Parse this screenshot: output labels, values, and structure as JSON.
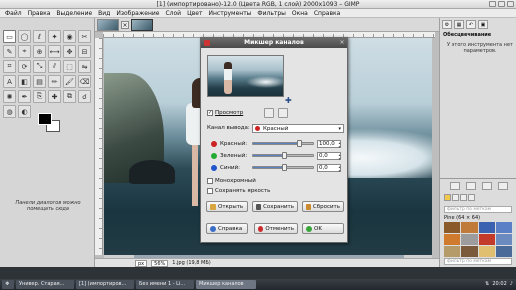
{
  "window": {
    "title": "[1] (импортировано)-12.0 (Цвета RGB, 1 слой) 2000x1093 – GIMP"
  },
  "menu": [
    "Файл",
    "Правка",
    "Выделение",
    "Вид",
    "Изображение",
    "Слой",
    "Цвет",
    "Инструменты",
    "Фильтры",
    "Окна",
    "Справка"
  ],
  "toolbox": {
    "tools": [
      "rect-select-icon",
      "ellipse-select-icon",
      "lasso-icon",
      "fuzzy-select-icon",
      "color-select-icon",
      "scissors-icon",
      "paths-icon",
      "color-picker-icon",
      "zoom-icon",
      "measure-icon",
      "move-icon",
      "align-icon",
      "crop-icon",
      "rotate-icon",
      "scale-icon",
      "shear-icon",
      "perspective-icon",
      "flip-icon",
      "text-icon",
      "bucket-fill-icon",
      "blend-icon",
      "pencil-icon",
      "paintbrush-icon",
      "eraser-icon",
      "airbrush-icon",
      "ink-icon",
      "clone-icon",
      "heal-icon",
      "perspective-clone-icon",
      "smudge-icon",
      "blur-icon",
      "dodge-icon"
    ],
    "tool_glyphs": [
      "▭",
      "◯",
      "ℓ",
      "✦",
      "◉",
      "✂",
      "✎",
      "⌖",
      "⊕",
      "⟷",
      "✥",
      "⊟",
      "⌗",
      "⟳",
      "⤡",
      "⫽",
      "⬚",
      "⇋",
      "A",
      "◧",
      "▤",
      "✏",
      "🖌",
      "⌫",
      "✺",
      "✒",
      "⎘",
      "✚",
      "⧉",
      "☌",
      "◍",
      "◐"
    ],
    "panel_note": "Панели диалогов можно помещать сюда"
  },
  "image_window": {
    "zoom_unit": "px",
    "zoom": "56%",
    "file_info": "1.jpg (19,8 МБ)"
  },
  "dock": {
    "title": "Обесцвечивание",
    "message": "У этого инструмента нет параметров.",
    "filter_placeholder": "фильтр по меткам",
    "pattern_label": "Pine (64 × 64)",
    "pattern_colors": [
      "#8a5a2b",
      "#c07a3a",
      "#3a62b0",
      "#5b7fc7",
      "#d07a2e",
      "#9c9c9c",
      "#c33a2a",
      "#6a8ac0",
      "#b59b6a",
      "#7a5a3a",
      "#e0c070",
      "#4a6a9a"
    ]
  },
  "dialog": {
    "title": "Микшер каналов",
    "preview_label": "Просмотр",
    "output_channel_label": "Канал вывода:",
    "output_channel_value": "Красный",
    "channels": [
      {
        "label": "Красный:",
        "value": "100,0",
        "color": "#cc2222",
        "fraction": 0.78
      },
      {
        "label": "Зеленый:",
        "value": "0,0",
        "color": "#22aa33",
        "fraction": 0.5
      },
      {
        "label": "Синий:",
        "value": "0,0",
        "color": "#2255cc",
        "fraction": 0.5
      }
    ],
    "monochrome_label": "Монохромный",
    "preserve_label": "Сохранять яркость",
    "open_label": "Открыть",
    "save_label": "Сохранить",
    "reset_label": "Сбросить",
    "help_label": "Справка",
    "cancel_label": "Отменить",
    "ok_label": "OK"
  },
  "taskbar": {
    "items": [
      "Универ. Старая...",
      "[1] (импортиров...",
      "Без имени 1 - Li...",
      "Микшер каналов"
    ],
    "time": "20:02"
  }
}
